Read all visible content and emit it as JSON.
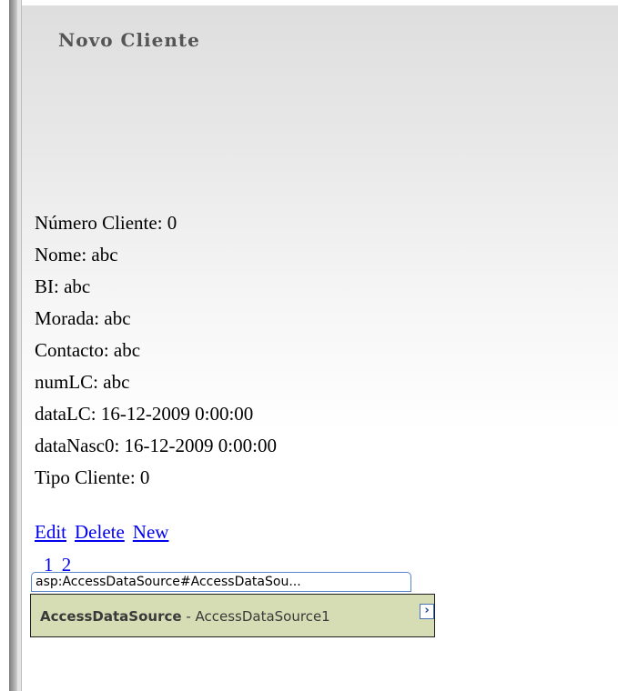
{
  "page": {
    "title": "Novo Cliente"
  },
  "fields": [
    {
      "label": "Número Cliente",
      "value": "0",
      "text": "Número Cliente: 0"
    },
    {
      "label": "Nome",
      "value": "abc",
      "text": "Nome: abc"
    },
    {
      "label": "BI",
      "value": "abc",
      "text": "BI: abc"
    },
    {
      "label": "Morada",
      "value": "abc",
      "text": "Morada: abc"
    },
    {
      "label": "Contacto",
      "value": "abc",
      "text": "Contacto: abc"
    },
    {
      "label": "numLC",
      "value": "abc",
      "text": "numLC: abc"
    },
    {
      "label": "dataLC",
      "value": "16-12-2009 0:00:00",
      "text": "dataLC: 16-12-2009 0:00:00"
    },
    {
      "label": "dataNasc0",
      "value": "16-12-2009 0:00:00",
      "text": "dataNasc0: 16-12-2009 0:00:00"
    },
    {
      "label": "Tipo Cliente",
      "value": "0",
      "text": "Tipo Cliente: 0"
    }
  ],
  "actions": {
    "edit": "Edit",
    "delete": "Delete",
    "new": "New"
  },
  "pager": {
    "text": "1 2"
  },
  "datasource": {
    "tag": "asp:AccessDataSource#AccessDataSou...",
    "type": "AccessDataSource",
    "separator": " - ",
    "id": "AccessDataSource1",
    "smart_tag_glyph": "›"
  },
  "colors": {
    "link": "#0000ee",
    "datasource_fill": "#d6dcb4",
    "tag_border": "#5a84c9"
  }
}
